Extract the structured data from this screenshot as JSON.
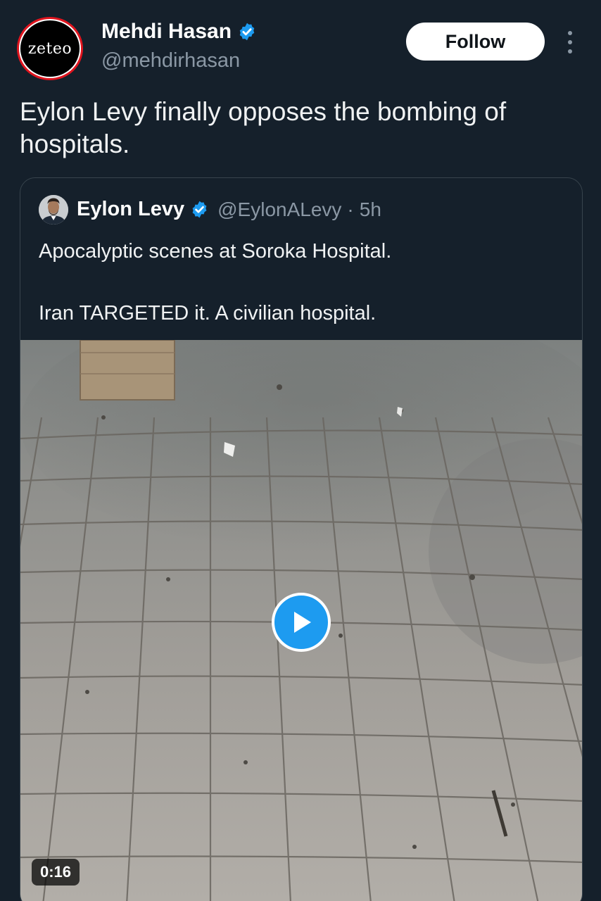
{
  "author": {
    "avatar_text": "zeteo",
    "display_name": "Mehdi Hasan",
    "handle": "@mehdirhasan",
    "verified": true
  },
  "actions": {
    "follow_label": "Follow",
    "more_icon": "more-vertical-icon"
  },
  "tweet": {
    "text": "Eylon Levy finally opposes the bombing of hospitals."
  },
  "quote": {
    "display_name": "Eylon Levy",
    "handle": "@EylonALevy",
    "separator": "·",
    "time": "5h",
    "verified": true,
    "text_line1": "Apocalyptic scenes at Soroka Hospital.",
    "text_line2": "Iran TARGETED it. A civilian hospital.",
    "video": {
      "duration": "0:16",
      "play_icon": "play-icon"
    }
  },
  "colors": {
    "background": "#15202b",
    "verified_blue": "#1d9bf0",
    "secondary_text": "#8b98a5",
    "card_border": "#38444d"
  }
}
